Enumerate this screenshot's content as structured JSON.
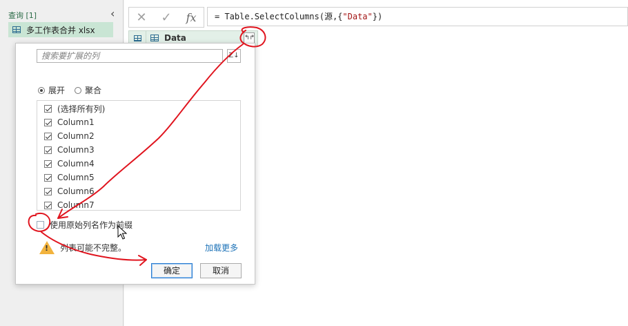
{
  "queries": {
    "header": "查询 [1]",
    "items": [
      {
        "label": "多工作表合并 xlsx"
      }
    ]
  },
  "formula_bar": {
    "prefix": "= Table.SelectColumns(源,{",
    "string": "\"Data\"",
    "suffix": "})"
  },
  "column": {
    "name": "Data"
  },
  "expand_popup": {
    "search_placeholder": "搜索要扩展的列",
    "radio": {
      "expand": "展开",
      "aggregate": "聚合"
    },
    "columns": [
      {
        "label": "(选择所有列)",
        "checked": true
      },
      {
        "label": "Column1",
        "checked": true
      },
      {
        "label": "Column2",
        "checked": true
      },
      {
        "label": "Column3",
        "checked": true
      },
      {
        "label": "Column4",
        "checked": true
      },
      {
        "label": "Column5",
        "checked": true
      },
      {
        "label": "Column6",
        "checked": true
      },
      {
        "label": "Column7",
        "checked": true
      }
    ],
    "prefix_label": "使用原始列名作为前缀",
    "warning": "列表可能不完整。",
    "load_more": "加载更多",
    "ok": "确定",
    "cancel": "取消"
  },
  "colors": {
    "accent_green": "#c9e5d4",
    "annotation_red": "#e0141e",
    "link_blue": "#1e73b8"
  }
}
